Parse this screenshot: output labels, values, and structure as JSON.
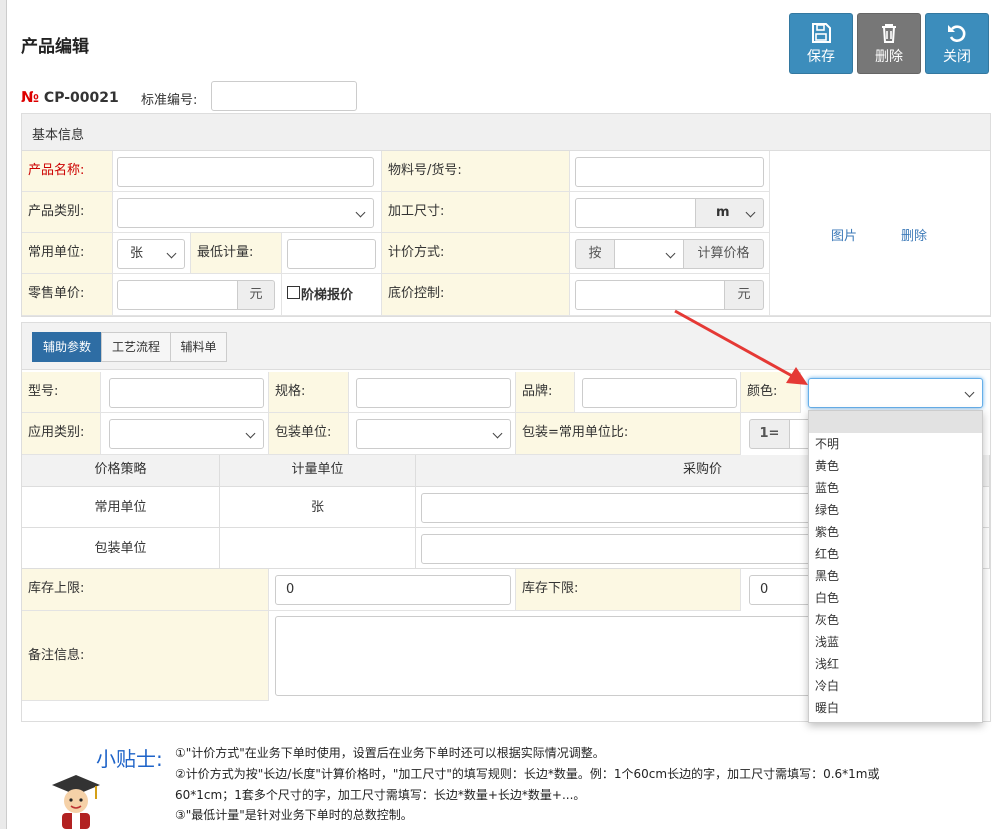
{
  "page_title": "产品编辑",
  "toolbar": {
    "save": "保存",
    "delete": "删除",
    "close": "关闭"
  },
  "product": {
    "no_symbol": "№",
    "no": "CP-00021",
    "std_label": "标准编号:",
    "std_value": ""
  },
  "basic": {
    "title": "基本信息",
    "name_label": "产品名称:",
    "name_value": "",
    "material_label": "物料号/货号:",
    "material_value": "",
    "category_label": "产品类别:",
    "category_value": "",
    "size_label": "加工尺寸:",
    "size_value": "",
    "size_unit": "m",
    "unit_label": "常用单位:",
    "unit_value": "张",
    "minqty_label": "最低计量:",
    "minqty_value": "",
    "pricing_label": "计价方式:",
    "pricing_prefix": "按",
    "pricing_value": "",
    "calc_button": "计算价格",
    "retail_label": "零售单价:",
    "retail_value": "",
    "yuan": "元",
    "tier_label": "阶梯报价",
    "floor_label": "底价控制:",
    "floor_value": "",
    "image_link": "图片",
    "image_delete": "删除"
  },
  "tabs": [
    {
      "label": "辅助参数",
      "active": true
    },
    {
      "label": "工艺流程"
    },
    {
      "label": "辅料单"
    }
  ],
  "aux": {
    "model_label": "型号:",
    "model_value": "",
    "spec_label": "规格:",
    "spec_value": "",
    "brand_label": "品牌:",
    "brand_value": "",
    "color_label": "颜色:",
    "color_value": "",
    "apptype_label": "应用类别:",
    "apptype_value": "",
    "pkgunit_label": "包装单位:",
    "pkgunit_value": "",
    "ratio_label": "包装=常用单位比:",
    "ratio_prefix": "1="
  },
  "price_table": {
    "headers": [
      "价格策略",
      "计量单位",
      "采购价"
    ],
    "rows": [
      {
        "strategy": "常用单位",
        "unit": "张"
      },
      {
        "strategy": "包装单位",
        "unit": ""
      }
    ]
  },
  "stock": {
    "upper_label": "库存上限:",
    "upper_value": "0",
    "lower_label": "库存下限:",
    "lower_value": "0"
  },
  "remark_label": "备注信息:",
  "color_options": [
    "",
    "不明",
    "黄色",
    "蓝色",
    "绿色",
    "紫色",
    "红色",
    "黑色",
    "白色",
    "灰色",
    "浅蓝",
    "浅红",
    "冷白",
    "暖白"
  ],
  "tips": {
    "title": "小贴士:",
    "lines": [
      "①\"计价方式\"在业务下单时使用，设置后在业务下单时还可以根据实际情况调整。",
      "②计价方式为按\"长边/长度\"计算价格时，\"加工尺寸\"的填写规则：长边*数量。例：1个60cm长边的字，加工尺寸需填写：0.6*1m或",
      "60*1cm；1套多个尺寸的字，加工尺寸需填写：长边*数量+长边*数量+...。",
      "③\"最低计量\"是针对业务下单时的总数控制。"
    ]
  },
  "colors": {
    "accent_blue": "#3c8dbc",
    "label_bg": "#fcf8e3",
    "required_red": "#cc0000",
    "arrow_red": "#e53935"
  }
}
